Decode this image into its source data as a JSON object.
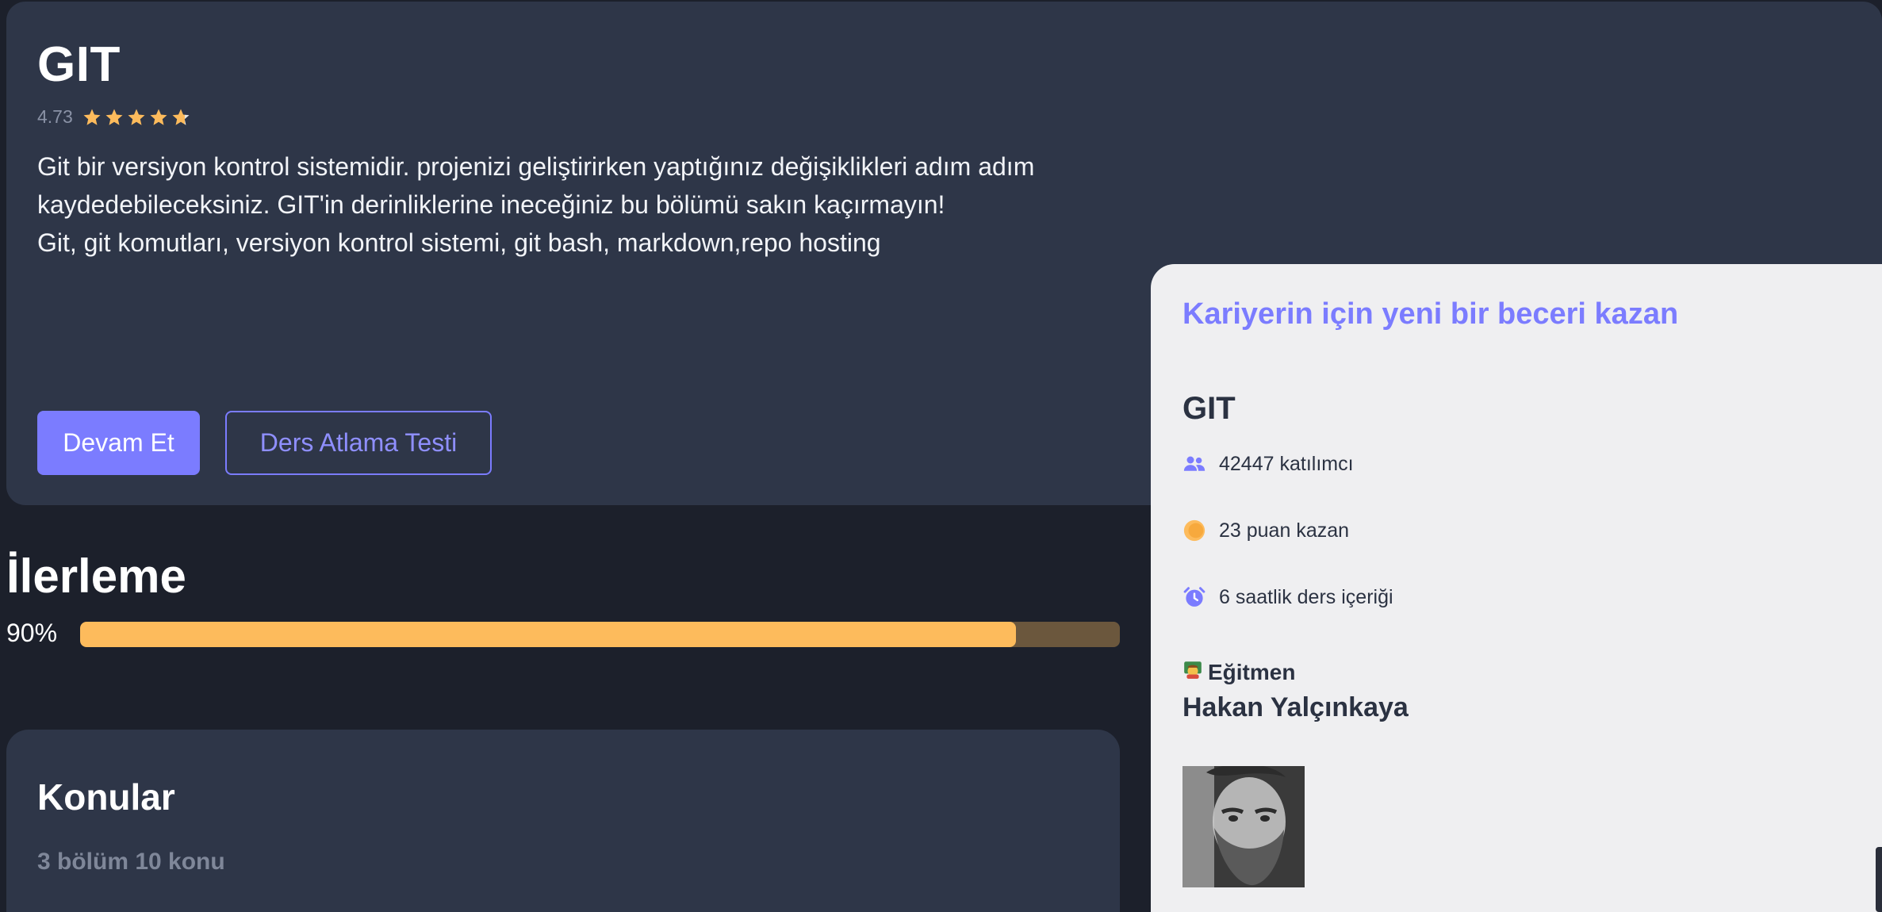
{
  "course": {
    "title": "GIT",
    "rating": "4.73",
    "rating_stars": 4.73,
    "description_line1": "Git bir versiyon kontrol sistemidir. projenizi geliştirirken yaptığınız değişiklikleri adım adım",
    "description_line2": "kaydedebileceksiniz. GIT'in derinliklerine ineceğiniz bu bölümü sakın kaçırmayın!",
    "tags": "Git, git komutları, versiyon kontrol sistemi, git bash, markdown,repo hosting",
    "continue_label": "Devam Et",
    "skip_test_label": "Ders Atlama Testi"
  },
  "progress": {
    "title": "İlerleme",
    "percent_label": "90%",
    "value": 0.9
  },
  "topics": {
    "title": "Konular",
    "summary": "3 bölüm 10 konu"
  },
  "side_panel": {
    "tagline": "Kariyerin için yeni bir beceri kazan",
    "course_title": "GIT",
    "participants": "42447 katılımcı",
    "points": "23 puan kazan",
    "duration": "6 saatlik ders içeriği",
    "instructor_label": "Eğitmen",
    "instructor_name": "Hakan Yalçınkaya"
  },
  "colors": {
    "accent": "#7b7cff",
    "progress_fill": "#fdbb5c",
    "card_bg": "#2e3648",
    "page_bg": "#1c202b"
  },
  "icons": {
    "participants": "users-icon",
    "points": "coin-icon",
    "duration": "alarm-clock-icon",
    "instructor": "teacher-emoji-icon"
  }
}
